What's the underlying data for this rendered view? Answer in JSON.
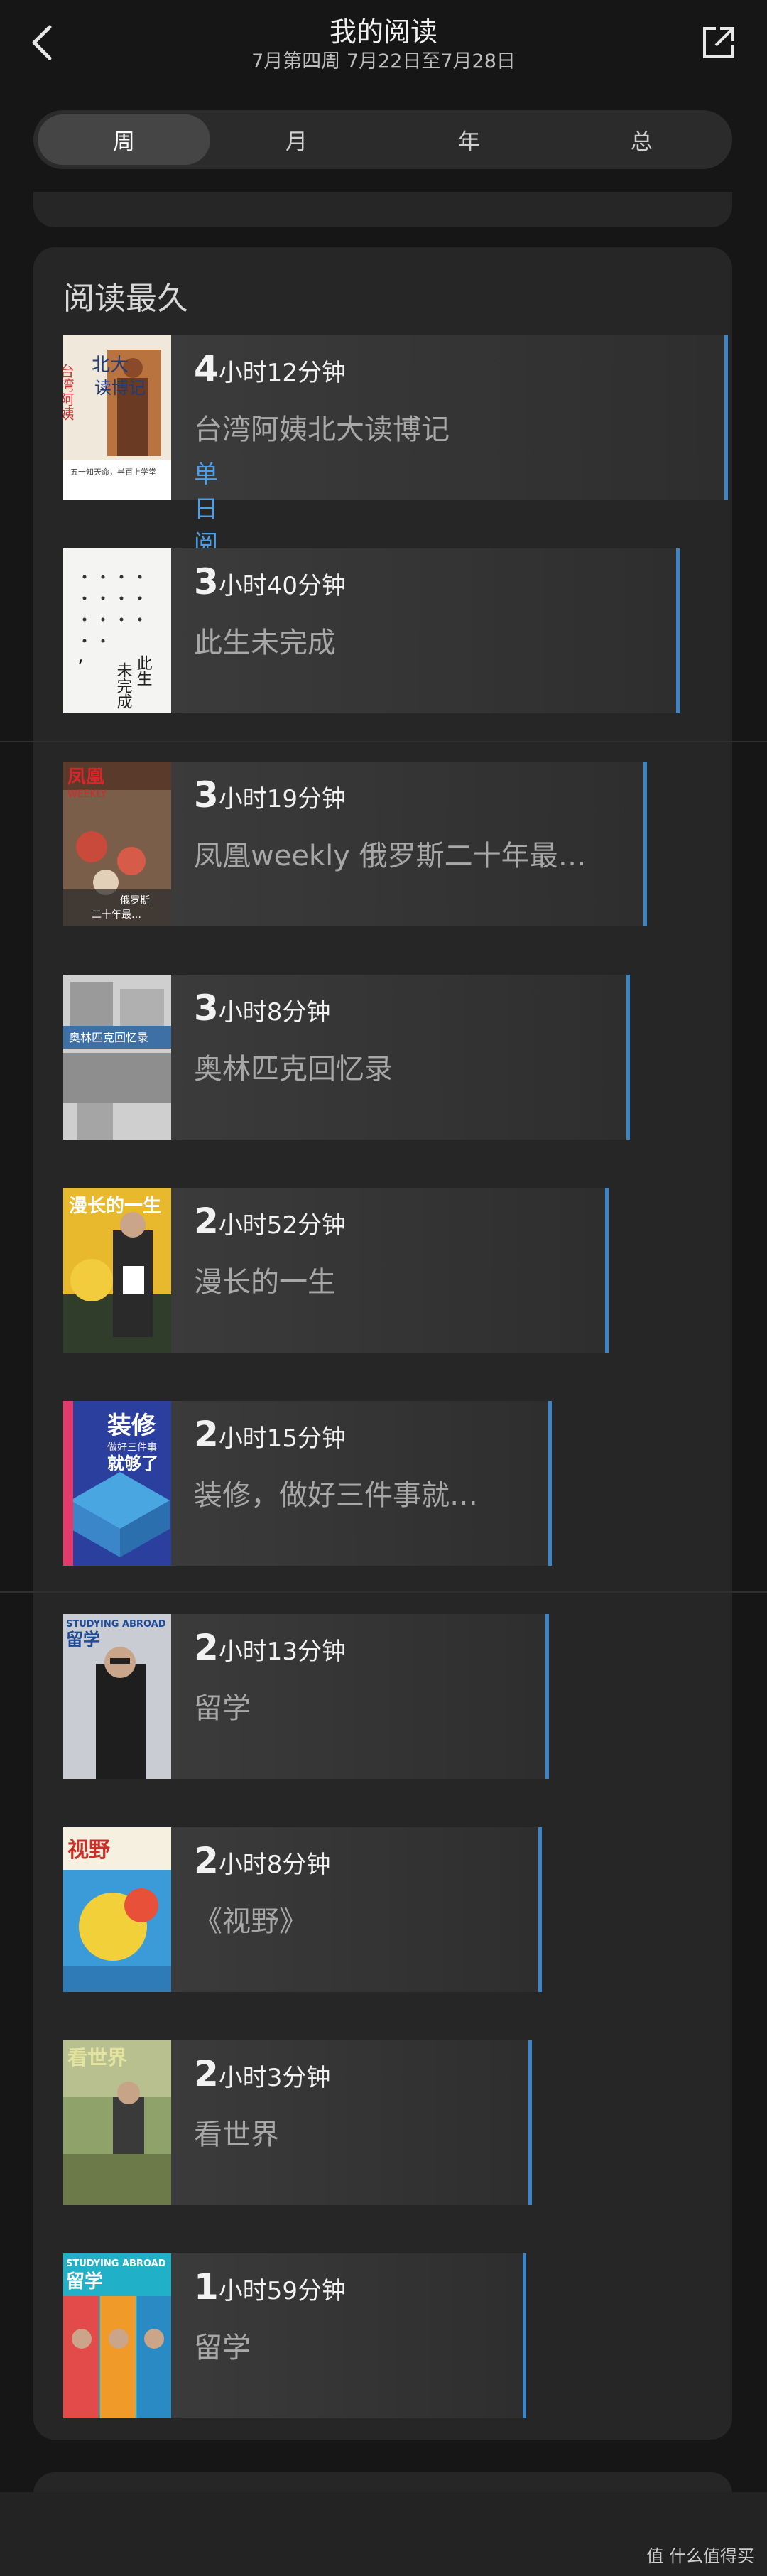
{
  "header": {
    "title": "我的阅读",
    "subtitle": "7月第四周 7月22日至7月28日"
  },
  "tabs": [
    {
      "label": "周",
      "active": true
    },
    {
      "label": "月",
      "active": false
    },
    {
      "label": "年",
      "active": false
    },
    {
      "label": "总",
      "active": false
    }
  ],
  "section": {
    "title": "阅读最久",
    "badge": "单日阅读最久",
    "books": [
      {
        "lead": "4",
        "rest": "小时12分钟",
        "title": "台湾阿姨北大读博记"
      },
      {
        "lead": "3",
        "rest": "小时40分钟",
        "title": "此生未完成"
      },
      {
        "lead": "3",
        "rest": "小时19分钟",
        "title": "凤凰weekly 俄罗斯二十年最…"
      },
      {
        "lead": "3",
        "rest": "小时8分钟",
        "title": "奥林匹克回忆录"
      },
      {
        "lead": "2",
        "rest": "小时52分钟",
        "title": "漫长的一生"
      },
      {
        "lead": "2",
        "rest": "小时15分钟",
        "title": "装修，做好三件事就…"
      },
      {
        "lead": "2",
        "rest": "小时13分钟",
        "title": "留学"
      },
      {
        "lead": "2",
        "rest": "小时8分钟",
        "title": "《视野》"
      },
      {
        "lead": "2",
        "rest": "小时3分钟",
        "title": "看世界"
      },
      {
        "lead": "1",
        "rest": "小时59分钟",
        "title": "留学"
      }
    ]
  },
  "covers": {
    "c1": {
      "text_a": "北大",
      "text_b": "读博记",
      "text_c": "台湾阿姨",
      "text_d": "五十知天命，半百上学堂"
    },
    "c2": {
      "text_a": "此生",
      "text_b": "未完成"
    },
    "c3": {
      "text_a": "凤凰",
      "text_b": "WEEKLY",
      "text_c": "俄罗斯",
      "text_d": "二十年最…"
    },
    "c4": {
      "text_a": "奥林匹克回忆录"
    },
    "c5": {
      "text_a": "漫长的一生"
    },
    "c6": {
      "text_a": "装修",
      "text_b": "做好三件事",
      "text_c": "就够了"
    },
    "c7": {
      "text_a": "STUDYING ABROAD",
      "text_b": "留学"
    },
    "c8": {
      "text_a": "视野"
    },
    "c9": {
      "text_a": "看世界"
    },
    "c10": {
      "text_a": "STUDYING ABROAD",
      "text_b": "留学"
    }
  },
  "watermark": "值 什么值得买",
  "colors": {
    "accent": "#3a86c8",
    "badge": "#4aa0ea",
    "background": "#161616",
    "card": "#262626"
  }
}
